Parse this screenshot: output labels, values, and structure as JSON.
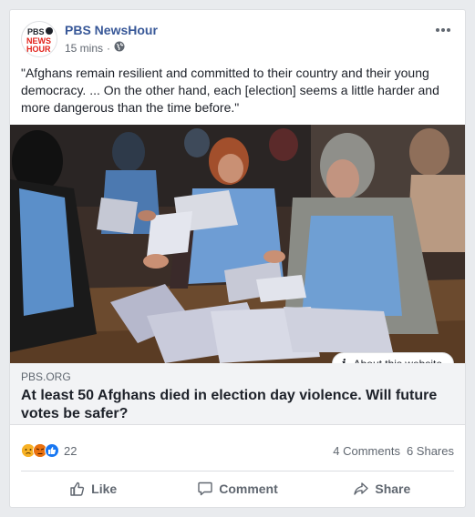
{
  "post": {
    "page_name": "PBS NewsHour",
    "time": "15 mins",
    "privacy_icon": "globe-icon",
    "message": "\"Afghans remain resilient and committed to their country and their young democracy. ... On the other hand, each [election] seems a little harder and more dangerous than the time before.\""
  },
  "link": {
    "domain": "PBS.ORG",
    "title": "At least 50 Afghans died in election day violence. Will future votes be safer?",
    "about_label": "About this website"
  },
  "avatar": {
    "line1": "PBS",
    "line2": "NEWS",
    "line3": "HOUR"
  },
  "engagement": {
    "reactions": [
      "sad-reaction-icon",
      "angry-reaction-icon",
      "like-reaction-icon"
    ],
    "reaction_count": "22",
    "comments": "4 Comments",
    "shares": "6 Shares"
  },
  "actions": {
    "like": "Like",
    "comment": "Comment",
    "share": "Share"
  },
  "colors": {
    "link_blue": "#385898",
    "like_blue": "#1877f2",
    "angry_red": "#e9710f",
    "sad_yellow": "#f7b125"
  }
}
